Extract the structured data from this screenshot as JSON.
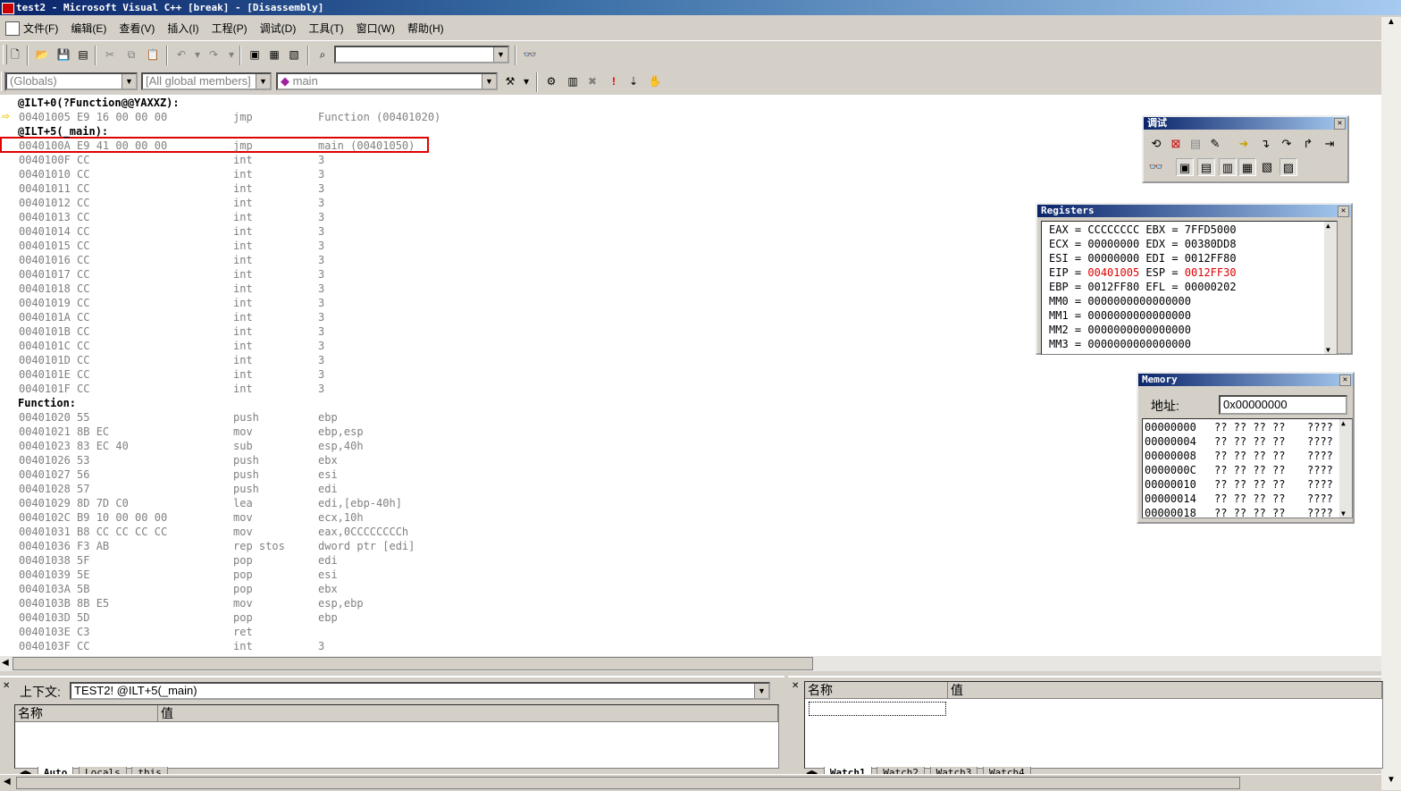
{
  "window": {
    "title": "test2 - Microsoft Visual C++ [break] - [Disassembly]"
  },
  "menu": {
    "items": [
      "文件(F)",
      "编辑(E)",
      "查看(V)",
      "插入(I)",
      "工程(P)",
      "调试(D)",
      "工具(T)",
      "窗口(W)",
      "帮助(H)"
    ]
  },
  "toolbar1": {
    "search_value": ""
  },
  "toolbar2": {
    "scope_combo": "(Globals)",
    "members_combo": "[All global members]",
    "function_combo": "main"
  },
  "code_lines": [
    {
      "t": "label",
      "a": "@ILT+0(?Function@@YAXXZ):"
    },
    {
      "a": "00401005 E9 16 00 00 00",
      "m": "jmp",
      "o": "Function (00401020)"
    },
    {
      "t": "label",
      "a": "@ILT+5(_main):"
    },
    {
      "a": "0040100A E9 41 00 00 00",
      "m": "jmp",
      "o": "main (00401050)"
    },
    {
      "a": "0040100F CC",
      "m": "int",
      "o": "3"
    },
    {
      "a": "00401010 CC",
      "m": "int",
      "o": "3"
    },
    {
      "a": "00401011 CC",
      "m": "int",
      "o": "3"
    },
    {
      "a": "00401012 CC",
      "m": "int",
      "o": "3"
    },
    {
      "a": "00401013 CC",
      "m": "int",
      "o": "3"
    },
    {
      "a": "00401014 CC",
      "m": "int",
      "o": "3"
    },
    {
      "a": "00401015 CC",
      "m": "int",
      "o": "3"
    },
    {
      "a": "00401016 CC",
      "m": "int",
      "o": "3"
    },
    {
      "a": "00401017 CC",
      "m": "int",
      "o": "3"
    },
    {
      "a": "00401018 CC",
      "m": "int",
      "o": "3"
    },
    {
      "a": "00401019 CC",
      "m": "int",
      "o": "3"
    },
    {
      "a": "0040101A CC",
      "m": "int",
      "o": "3"
    },
    {
      "a": "0040101B CC",
      "m": "int",
      "o": "3"
    },
    {
      "a": "0040101C CC",
      "m": "int",
      "o": "3"
    },
    {
      "a": "0040101D CC",
      "m": "int",
      "o": "3"
    },
    {
      "a": "0040101E CC",
      "m": "int",
      "o": "3"
    },
    {
      "a": "0040101F CC",
      "m": "int",
      "o": "3"
    },
    {
      "t": "label",
      "a": "Function:"
    },
    {
      "a": "00401020 55",
      "m": "push",
      "o": "ebp"
    },
    {
      "a": "00401021 8B EC",
      "m": "mov",
      "o": "ebp,esp"
    },
    {
      "a": "00401023 83 EC 40",
      "m": "sub",
      "o": "esp,40h"
    },
    {
      "a": "00401026 53",
      "m": "push",
      "o": "ebx"
    },
    {
      "a": "00401027 56",
      "m": "push",
      "o": "esi"
    },
    {
      "a": "00401028 57",
      "m": "push",
      "o": "edi"
    },
    {
      "a": "00401029 8D 7D C0",
      "m": "lea",
      "o": "edi,[ebp-40h]"
    },
    {
      "a": "0040102C B9 10 00 00 00",
      "m": "mov",
      "o": "ecx,10h"
    },
    {
      "a": "00401031 B8 CC CC CC CC",
      "m": "mov",
      "o": "eax,0CCCCCCCCh"
    },
    {
      "a": "00401036 F3 AB",
      "m": "rep stos",
      "o": "dword ptr [edi]"
    },
    {
      "a": "00401038 5F",
      "m": "pop",
      "o": "edi"
    },
    {
      "a": "00401039 5E",
      "m": "pop",
      "o": "esi"
    },
    {
      "a": "0040103A 5B",
      "m": "pop",
      "o": "ebx"
    },
    {
      "a": "0040103B 8B E5",
      "m": "mov",
      "o": "esp,ebp"
    },
    {
      "a": "0040103D 5D",
      "m": "pop",
      "o": "ebp"
    },
    {
      "a": "0040103E C3",
      "m": "ret",
      "o": ""
    },
    {
      "a": "0040103F CC",
      "m": "int",
      "o": "3"
    }
  ],
  "debug_toolbar": {
    "title": "调试"
  },
  "registers": {
    "title": "Registers",
    "lines": [
      {
        "l": "EAX",
        "v": "CCCCCCCC",
        "l2": "EBX",
        "v2": "7FFD5000"
      },
      {
        "l": "ECX",
        "v": "00000000",
        "l2": "EDX",
        "v2": "00380DD8"
      },
      {
        "l": "ESI",
        "v": "00000000",
        "l2": "EDI",
        "v2": "0012FF80"
      },
      {
        "l": "EIP",
        "v": "00401005",
        "l2": "ESP",
        "v2": "0012FF30",
        "changed": true
      },
      {
        "l": "EBP",
        "v": "0012FF80",
        "l2": "EFL",
        "v2": "00000202"
      },
      {
        "l": "MM0",
        "v": "0000000000000000"
      },
      {
        "l": "MM1",
        "v": "0000000000000000"
      },
      {
        "l": "MM2",
        "v": "0000000000000000"
      },
      {
        "l": "MM3",
        "v": "0000000000000000"
      }
    ]
  },
  "memory": {
    "title": "Memory",
    "address_label": "地址:",
    "address_value": "0x00000000",
    "rows": [
      {
        "a": "00000000",
        "b": "?? ?? ?? ??",
        "c": "????"
      },
      {
        "a": "00000004",
        "b": "?? ?? ?? ??",
        "c": "????"
      },
      {
        "a": "00000008",
        "b": "?? ?? ?? ??",
        "c": "????"
      },
      {
        "a": "0000000C",
        "b": "?? ?? ?? ??",
        "c": "????"
      },
      {
        "a": "00000010",
        "b": "?? ?? ?? ??",
        "c": "????"
      },
      {
        "a": "00000014",
        "b": "?? ?? ?? ??",
        "c": "????"
      },
      {
        "a": "00000018",
        "b": "?? ?? ?? ??",
        "c": "????"
      }
    ]
  },
  "variables": {
    "context_label": "上下文:",
    "context_value": "TEST2! @ILT+5(_main)",
    "col_name": "名称",
    "col_value": "值",
    "tabs": [
      "Auto",
      "Locals",
      "this"
    ]
  },
  "watch": {
    "col_name": "名称",
    "col_value": "值",
    "tabs": [
      "Watch1",
      "Watch2",
      "Watch3",
      "Watch4"
    ]
  },
  "colors": {
    "highlight_box": "#e00000",
    "changed_register": "#e00000",
    "title_gradient_start": "#0a246a"
  }
}
